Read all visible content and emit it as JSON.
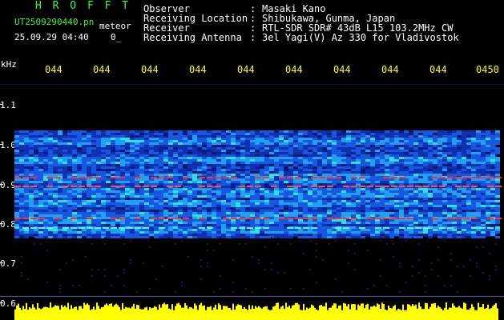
{
  "header": {
    "app_title": "H R O F F T",
    "file_name": "UT2509290440.pn",
    "meteor_label": "meteor",
    "datetime": "25.09.29 04:40",
    "count": "0_"
  },
  "info": [
    {
      "label": "Observer",
      "value": "Masaki Kano"
    },
    {
      "label": "Receiving Location",
      "value": "Shibukawa, Gunma, Japan"
    },
    {
      "label": "Receiver",
      "value": "RTL-SDR SDR# 43dB L15 103.2MHz CW"
    },
    {
      "label": "Receiving Antenna",
      "value": "3el Yagi(V) Az 330 for Vladivostok"
    }
  ],
  "axis": {
    "unit": "kHz",
    "y_ticks": [
      "1.1",
      "1.0",
      "0.9",
      "0.8",
      "0.7",
      "0.6"
    ],
    "x_ticks": [
      "044",
      "044",
      "044",
      "044",
      "044",
      "044",
      "044",
      "044",
      "044",
      "0450"
    ]
  },
  "colors": {
    "title_green": "#33ff33",
    "tick_yellow": "#ffff00",
    "background": "#000000",
    "signal_line": "#ff3030",
    "noise_base": "#0a1e8c"
  }
}
